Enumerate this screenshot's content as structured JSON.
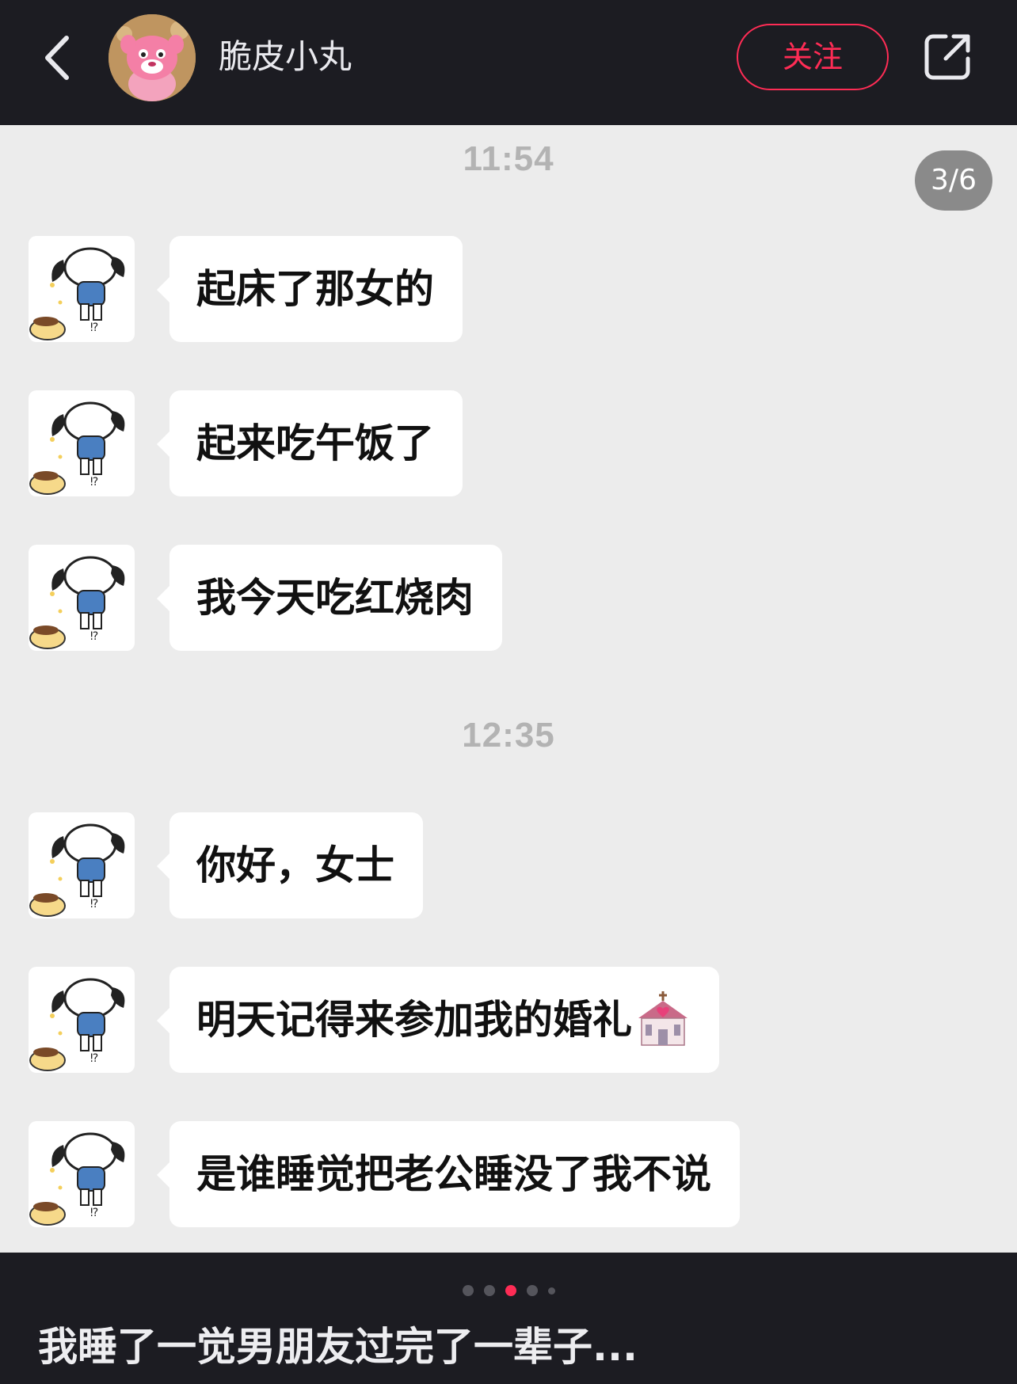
{
  "header": {
    "username": "脆皮小丸",
    "follow_label": "关注",
    "back_icon": "chevron-left-icon",
    "share_icon": "share-external-icon"
  },
  "chat": {
    "page_indicator": "3/6",
    "groups": [
      {
        "time": "11:54",
        "messages": [
          "起床了那女的",
          "起来吃午饭了",
          "我今天吃红烧肉"
        ]
      },
      {
        "time": "12:35",
        "messages": [
          "你好，女士",
          "明天记得来参加我的婚礼",
          "是谁睡觉把老公睡没了我不说"
        ]
      }
    ],
    "emoji": "wedding-chapel-emoji"
  },
  "carousel": {
    "total_dots": 5,
    "active_index": 2
  },
  "caption": "我睡了一觉男朋友过完了一辈子...",
  "colors": {
    "accent": "#fe2c55",
    "dark_bg": "#1c1c22",
    "chat_bg": "#ececec"
  }
}
